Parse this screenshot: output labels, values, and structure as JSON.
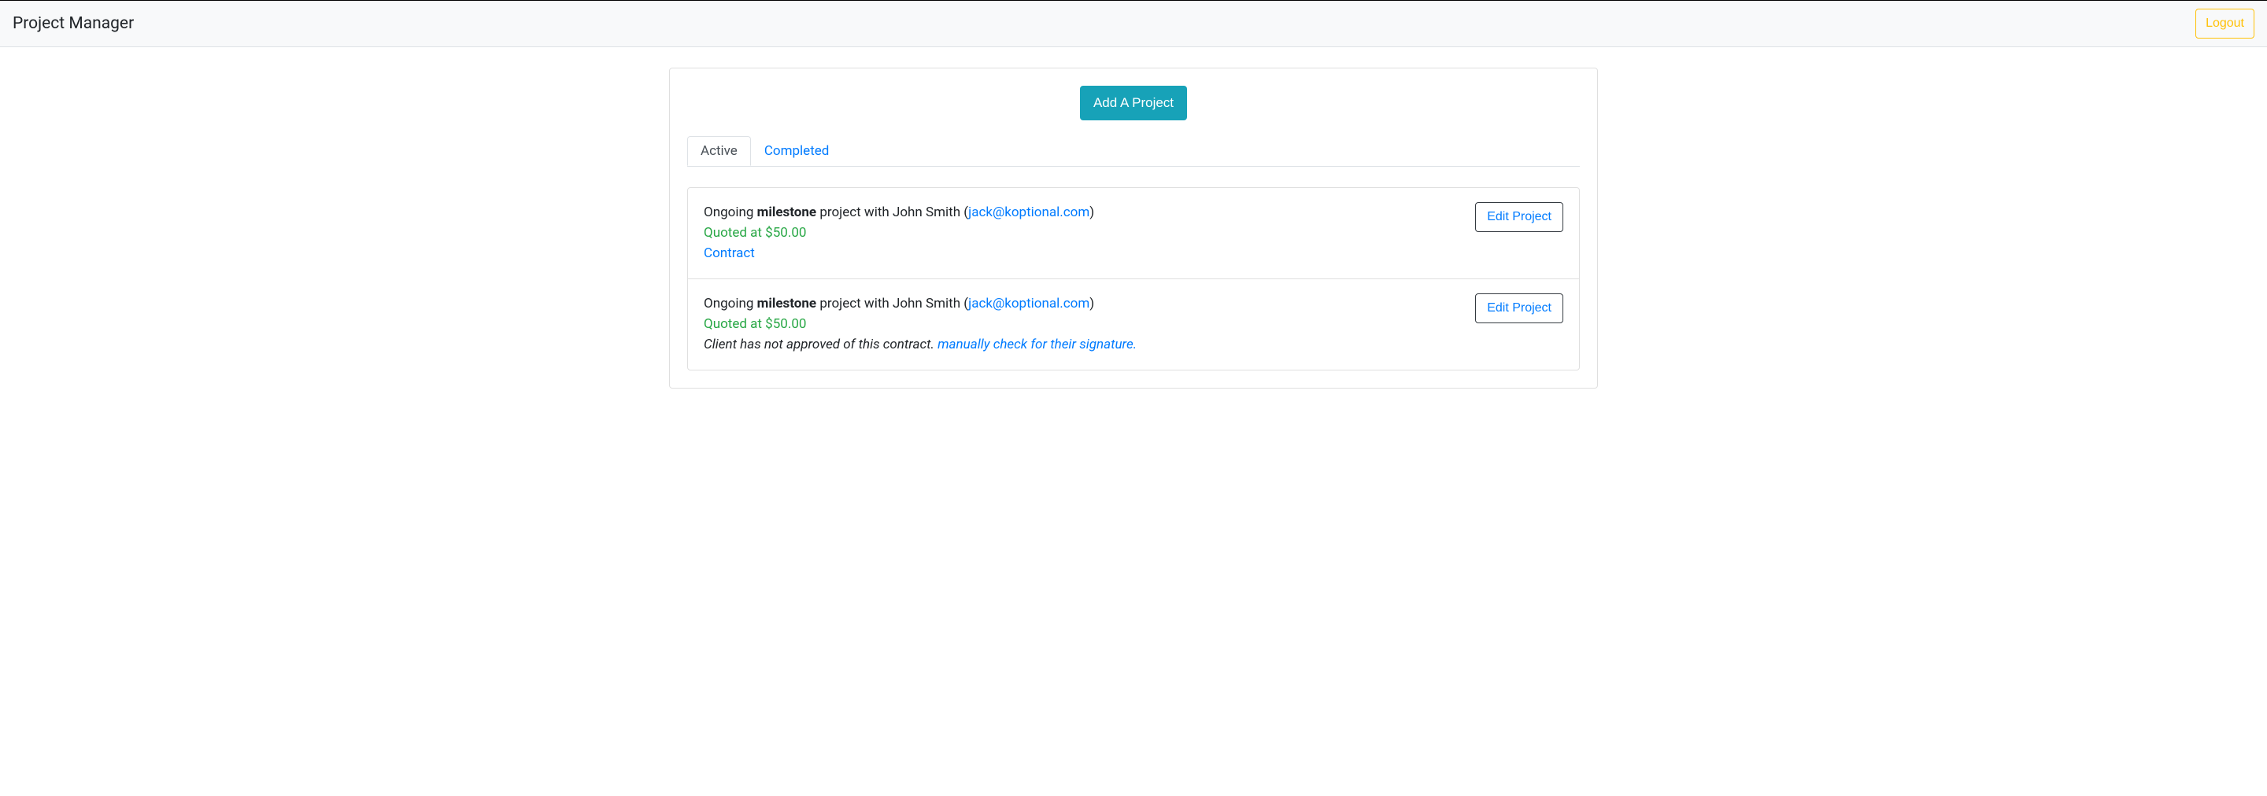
{
  "navbar": {
    "brand": "Project Manager",
    "logout": "Logout"
  },
  "main": {
    "add_project_label": "Add A Project",
    "tabs": [
      {
        "label": "Active",
        "active": true
      },
      {
        "label": "Completed",
        "active": false
      }
    ],
    "projects": [
      {
        "prefix": "Ongoing ",
        "type": "milestone",
        "with_text": " project with John Smith (",
        "email": "jack@koptional.com",
        "close_paren": ")",
        "quote": "Quoted at $50.00",
        "contract_link": "Contract",
        "pending_text": "",
        "pending_link": "",
        "edit_label": "Edit Project"
      },
      {
        "prefix": "Ongoing ",
        "type": "milestone",
        "with_text": " project with John Smith (",
        "email": "jack@koptional.com",
        "close_paren": ")",
        "quote": "Quoted at $50.00",
        "contract_link": "",
        "pending_text": "Client has not approved of this contract. ",
        "pending_link": "manually check for their signature.",
        "edit_label": "Edit Project"
      }
    ]
  }
}
